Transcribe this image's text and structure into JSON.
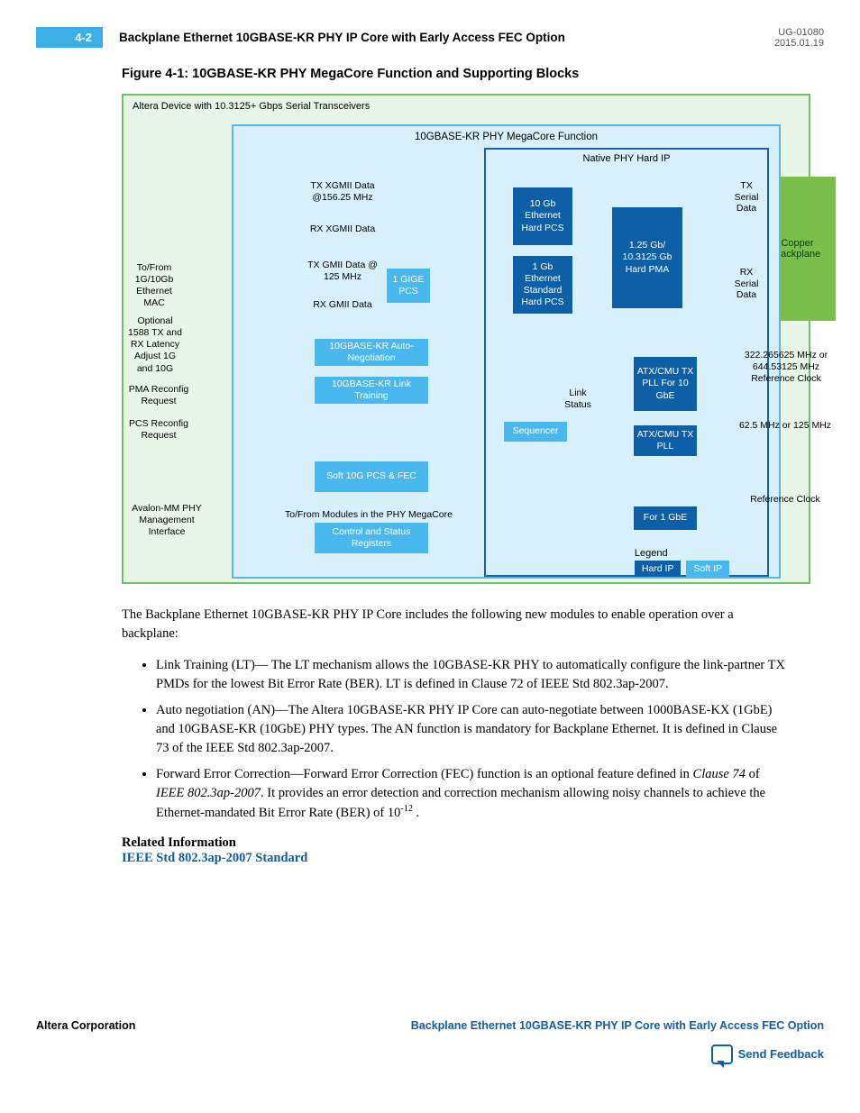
{
  "header": {
    "page_num": "4-2",
    "title": "Backplane Ethernet 10GBASE-KR PHY IP Core with Early Access FEC Option",
    "doc_id": "UG-01080",
    "date": "2015.01.19"
  },
  "figure": {
    "title": "Figure 4-1: 10GBASE-KR PHY MegaCore Function and Supporting Blocks",
    "device_label": "Altera Device with 10.3125+ Gbps Serial Transceivers",
    "megacore_label": "10GBASE-KR PHY MegaCore Function",
    "native_label": "Native PHY Hard IP",
    "left_labels": {
      "mac": "To/From 1G/10Gb Ethernet MAC",
      "optional": "Optional 1588 TX and RX Latency Adjust 1G and 10G",
      "pma": "PMA Reconfig Request",
      "pcs": "PCS Reconfig Request",
      "avalon": "Avalon-MM PHY Management Interface"
    },
    "soft_blocks": {
      "gige_pcs": "1 GIGE PCS",
      "auto_neg": "10GBASE-KR Auto-Negotiation",
      "link_train": "10GBASE-KR Link Training",
      "soft10g": "Soft 10G PCS & FEC",
      "csr": "Control and Status Registers",
      "sequencer": "Sequencer"
    },
    "hard_blocks": {
      "pcs10g": "10 Gb Ethernet Hard PCS",
      "pcs1g": "1 Gb Ethernet Standard Hard PCS",
      "pma": "1.25 Gb/ 10.3125 Gb Hard PMA",
      "pll10g": "ATX/CMU TX PLL For 10 GbE",
      "pll1g_a": "ATX/CMU TX PLL",
      "pll1g_b": "For 1 GbE"
    },
    "signals": {
      "tx_xgmii": "TX XGMII Data @156.25 MHz",
      "rx_xgmii": "RX XGMII Data",
      "tx_gmii": "TX GMII Data @ 125 MHz",
      "rx_gmii": "RX GMII Data",
      "csr_path": "To/From Modules in the PHY MegaCore",
      "link_status": "Link Status",
      "tx_serial": "TX Serial Data",
      "rx_serial": "RX Serial Data"
    },
    "right_labels": {
      "backplane": "Copper Backplane",
      "clk10g": "322.265625 MHz or 644.53125 MHz Reference Clock",
      "clk1g": "62.5 MHz or 125 MHz",
      "refclk": "Reference Clock"
    },
    "legend": {
      "title": "Legend",
      "hard": "Hard IP",
      "soft": "Soft IP"
    }
  },
  "body": {
    "intro": "The Backplane Ethernet 10GBASE-KR PHY IP Core includes the following new modules to enable operation over a backplane:",
    "bullets": [
      "Link Training (LT)— The LT mechanism allows the 10GBASE-KR PHY to automatically configure the link-partner TX PMDs for the lowest Bit Error Rate (BER). LT is defined in Clause 72 of IEEE Std 802.3ap-2007.",
      "Auto negotiation (AN)—The Altera 10GBASE-KR PHY IP Core can auto-negotiate between 1000BASE-KX (1GbE) and 10GBASE-KR (10GbE) PHY types. The AN function is mandatory for Backplane Ethernet. It is defined in Clause 73 of the IEEE Std 802.3ap-2007.",
      "Forward Error Correction—Forward Error Correction (FEC) function is an optional feature defined in <em>Clause 74</em> of <em>IEEE 802.3ap-2007</em>. It provides an error detection and correction mechanism allowing noisy channels to achieve the Ethernet-mandated Bit Error Rate (BER) of 10<sup>-12</sup> ."
    ],
    "related_title": "Related Information",
    "related_link": "IEEE Std 802.3ap-2007 Standard"
  },
  "footer": {
    "left": "Altera Corporation",
    "right": "Backplane Ethernet 10GBASE-KR PHY IP Core with Early Access FEC Option",
    "feedback": "Send Feedback"
  }
}
